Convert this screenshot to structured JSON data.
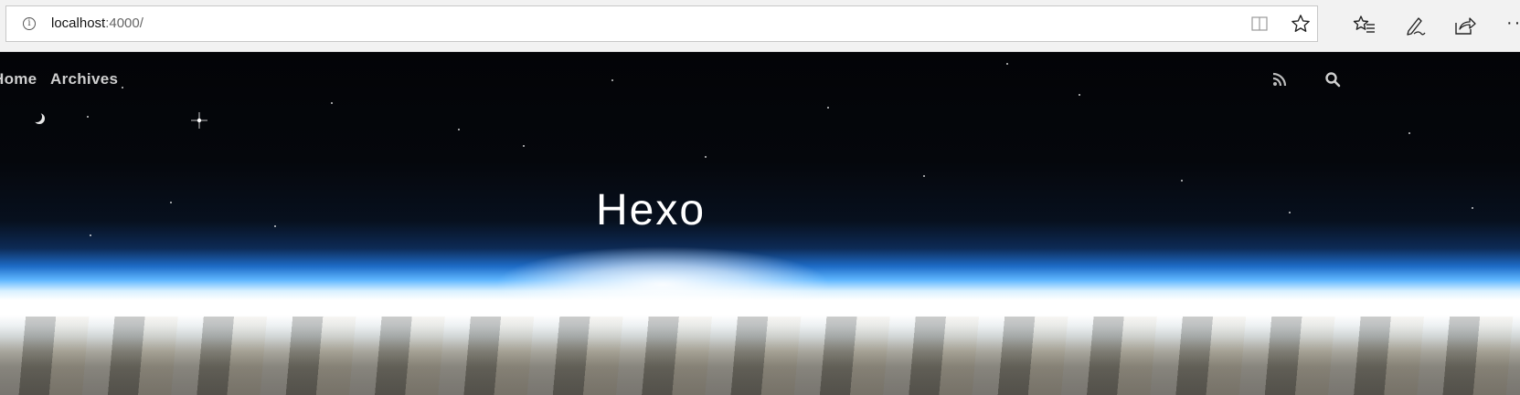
{
  "browser": {
    "url_host": "localhost",
    "url_path": ":4000/",
    "icons": {
      "site_info": "info-icon",
      "reading_view": "reading-view-icon",
      "favorite": "star-icon",
      "favorites_list": "favorites-list-icon",
      "notes": "pen-icon",
      "share": "share-icon",
      "more": "more-icon"
    }
  },
  "site": {
    "nav": {
      "home_label": "Home",
      "archives_label": "Archives"
    },
    "title": "Hexo",
    "icons": {
      "rss": "rss-icon",
      "search": "search-icon"
    }
  }
}
